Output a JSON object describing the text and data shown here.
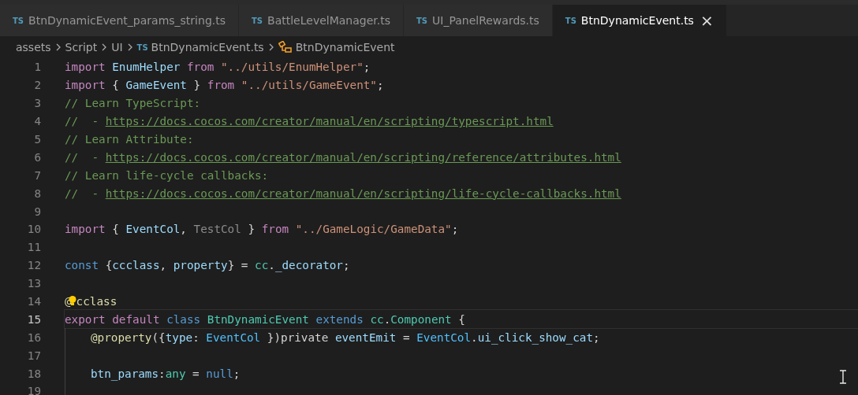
{
  "tabs": [
    {
      "badge": "TS",
      "label": "BtnDynamicEvent_params_string.ts",
      "selected": false
    },
    {
      "badge": "TS",
      "label": "BattleLevelManager.ts",
      "selected": false
    },
    {
      "badge": "TS",
      "label": "UI_PanelRewards.ts",
      "selected": false
    },
    {
      "badge": "TS",
      "label": "BtnDynamicEvent.ts",
      "selected": true,
      "close": "×"
    }
  ],
  "breadcrumbs": [
    {
      "kind": "folder",
      "label": "assets"
    },
    {
      "kind": "folder",
      "label": "Script"
    },
    {
      "kind": "folder",
      "label": "UI"
    },
    {
      "kind": "file",
      "badge": "TS",
      "label": "BtnDynamicEvent.ts"
    },
    {
      "kind": "class",
      "label": "BtnDynamicEvent"
    }
  ],
  "lines": [
    {
      "number": "1",
      "current": false,
      "tokens": [
        {
          "kind": "keyword",
          "text": "import "
        },
        {
          "kind": "variable",
          "text": "EnumHelper "
        },
        {
          "kind": "keyword",
          "text": "from "
        },
        {
          "kind": "string",
          "text": "\"../utils/EnumHelper\""
        },
        {
          "kind": "plain",
          "text": ";"
        }
      ]
    },
    {
      "number": "2",
      "current": false,
      "tokens": [
        {
          "kind": "keyword",
          "text": "import"
        },
        {
          "kind": "plain",
          "text": " { "
        },
        {
          "kind": "variable",
          "text": "GameEvent"
        },
        {
          "kind": "plain",
          "text": " } "
        },
        {
          "kind": "keyword",
          "text": "from "
        },
        {
          "kind": "string",
          "text": "\"../utils/GameEvent\""
        },
        {
          "kind": "plain",
          "text": ";"
        }
      ]
    },
    {
      "number": "3",
      "current": false,
      "tokens": [
        {
          "kind": "comment",
          "text": "// Learn TypeScript:"
        }
      ]
    },
    {
      "number": "4",
      "current": false,
      "tokens": [
        {
          "kind": "comment",
          "text": "//  - "
        },
        {
          "kind": "link",
          "text": "https://docs.cocos.com/creator/manual/en/scripting/typescript.html"
        }
      ]
    },
    {
      "number": "5",
      "current": false,
      "tokens": [
        {
          "kind": "comment",
          "text": "// Learn Attribute:"
        }
      ]
    },
    {
      "number": "6",
      "current": false,
      "tokens": [
        {
          "kind": "comment",
          "text": "//  - "
        },
        {
          "kind": "link",
          "text": "https://docs.cocos.com/creator/manual/en/scripting/reference/attributes.html"
        }
      ]
    },
    {
      "number": "7",
      "current": false,
      "tokens": [
        {
          "kind": "comment",
          "text": "// Learn life-cycle callbacks:"
        }
      ]
    },
    {
      "number": "8",
      "current": false,
      "tokens": [
        {
          "kind": "comment",
          "text": "//  - "
        },
        {
          "kind": "link",
          "text": "https://docs.cocos.com/creator/manual/en/scripting/life-cycle-callbacks.html"
        }
      ]
    },
    {
      "number": "9",
      "current": false
    },
    {
      "number": "10",
      "current": false,
      "tokens": [
        {
          "kind": "keyword",
          "text": "import"
        },
        {
          "kind": "plain",
          "text": " { "
        },
        {
          "kind": "variable",
          "text": "EventCol"
        },
        {
          "kind": "plain",
          "text": ", "
        },
        {
          "kind": "unused",
          "text": "TestCol"
        },
        {
          "kind": "plain",
          "text": " } "
        },
        {
          "kind": "keyword",
          "text": "from "
        },
        {
          "kind": "string",
          "text": "\"../GameLogic/GameData\""
        },
        {
          "kind": "plain",
          "text": ";"
        }
      ]
    },
    {
      "number": "11",
      "current": false
    },
    {
      "number": "12",
      "current": false,
      "tokens": [
        {
          "kind": "storage",
          "text": "const"
        },
        {
          "kind": "plain",
          "text": " {"
        },
        {
          "kind": "variable",
          "text": "ccclass"
        },
        {
          "kind": "plain",
          "text": ", "
        },
        {
          "kind": "variable",
          "text": "property"
        },
        {
          "kind": "plain",
          "text": "} = "
        },
        {
          "kind": "type",
          "text": "cc"
        },
        {
          "kind": "plain",
          "text": "."
        },
        {
          "kind": "variable",
          "text": "_decorator"
        },
        {
          "kind": "plain",
          "text": ";"
        }
      ]
    },
    {
      "number": "13",
      "current": false
    },
    {
      "number": "14",
      "current": false,
      "tokens": [
        {
          "kind": "decorator",
          "text": "@"
        },
        {
          "kind": "bulb"
        },
        {
          "kind": "decorator",
          "text": "cclass"
        }
      ]
    },
    {
      "number": "15",
      "current": true,
      "tokens": [
        {
          "kind": "keyword",
          "text": "export "
        },
        {
          "kind": "keyword",
          "text": "default "
        },
        {
          "kind": "storage",
          "text": "class "
        },
        {
          "kind": "type",
          "text": "BtnDynamicEvent "
        },
        {
          "kind": "storage",
          "text": "extends "
        },
        {
          "kind": "type",
          "text": "cc"
        },
        {
          "kind": "plain",
          "text": "."
        },
        {
          "kind": "type",
          "text": "Component"
        },
        {
          "kind": "plain",
          "text": " {"
        }
      ],
      "children": [
        {
          "number": "16",
          "current": false,
          "tokens": [
            {
              "kind": "decorator",
              "text": "@property"
            },
            {
              "kind": "plain",
              "text": "({"
            },
            {
              "kind": "variable",
              "text": "type"
            },
            {
              "kind": "plain",
              "text": ": "
            },
            {
              "kind": "constant",
              "text": "EventCol"
            },
            {
              "kind": "plain",
              "text": " })private "
            },
            {
              "kind": "variable",
              "text": "eventEmit"
            },
            {
              "kind": "plain",
              "text": " = "
            },
            {
              "kind": "constant",
              "text": "EventCol"
            },
            {
              "kind": "plain",
              "text": "."
            },
            {
              "kind": "variable",
              "text": "ui_click_show_cat"
            },
            {
              "kind": "plain",
              "text": ";"
            }
          ]
        },
        {
          "number": "17",
          "current": false
        },
        {
          "number": "18",
          "current": false,
          "tokens": [
            {
              "kind": "variable",
              "text": "btn_params"
            },
            {
              "kind": "plain",
              "text": ":"
            },
            {
              "kind": "type",
              "text": "any"
            },
            {
              "kind": "plain",
              "text": " = "
            },
            {
              "kind": "storage",
              "text": "null"
            },
            {
              "kind": "plain",
              "text": ";"
            }
          ]
        },
        {
          "number": "19",
          "current": false
        }
      ]
    }
  ]
}
